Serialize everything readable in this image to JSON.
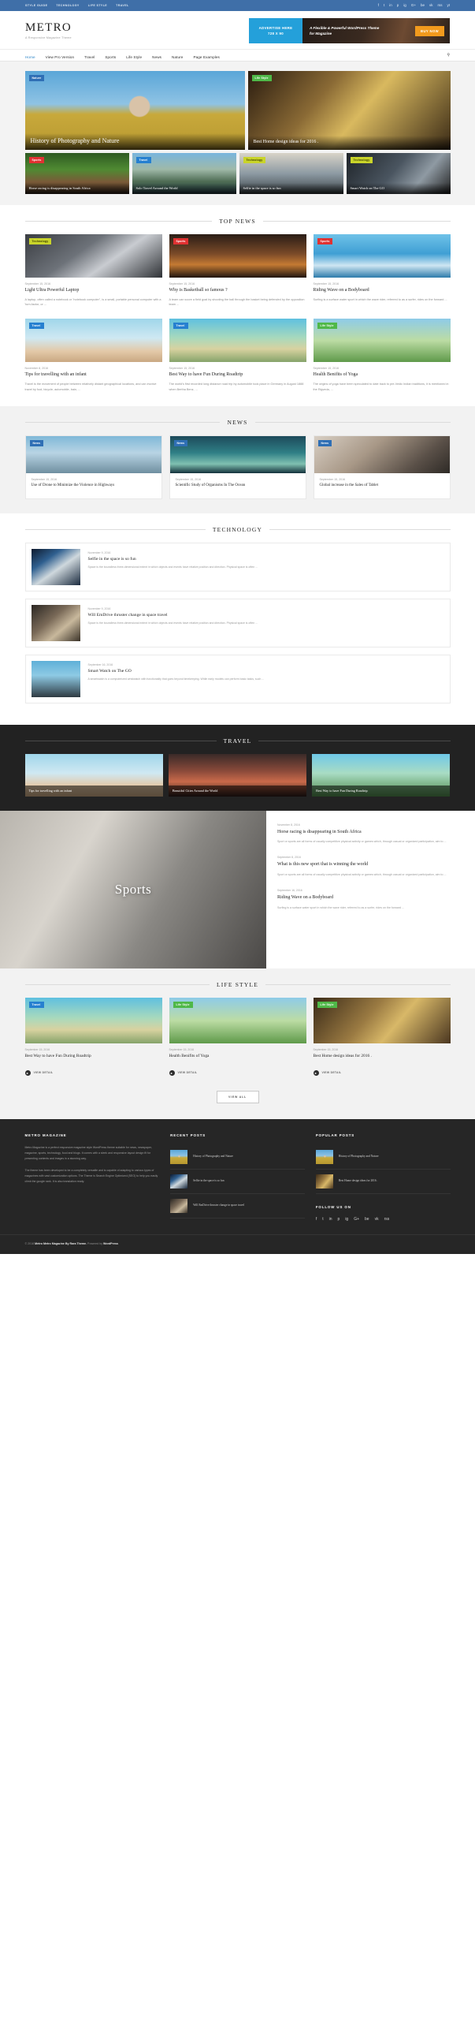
{
  "topbar": {
    "links": [
      "STYLE GUIDE",
      "TECHNOLOGY",
      "LIFE STYLE",
      "TRAVEL"
    ],
    "social": [
      "f",
      "t",
      "in",
      "p",
      "ig",
      "G+",
      "be",
      "vk",
      "rss",
      "yt"
    ],
    "bg": "#3f6fa8"
  },
  "header": {
    "title": "METRO",
    "tagline": "A Responsive Magazine Theme",
    "ad": {
      "left_line1": "ADVERTISE HERE",
      "left_line2": "728 X 90",
      "text": "A Flexible & Powerful WordPress Theme for Magazine",
      "button": "BUY NOW",
      "accent": "#24a0da",
      "button_color": "#f29a1d"
    }
  },
  "nav": {
    "items": [
      "Home",
      "View Pro Version",
      "Travel",
      "Sports",
      "Life Style",
      "News",
      "Nature",
      "Page Examples"
    ],
    "active": "Home",
    "search_icon": "search-icon"
  },
  "hero": {
    "main": {
      "badge": "Nature",
      "badge_class": "b-nature",
      "title": "History of Photography and Nature",
      "img": "i-photographer"
    },
    "side": {
      "badge": "Life Style",
      "badge_class": "b-life",
      "title": "Best Home design ideas for 2016 .",
      "img": "i-interior"
    },
    "small": [
      {
        "badge": "Sports",
        "badge_class": "b-sports",
        "title": "Horse racing is disappearing in South Africa",
        "img": "i-horse"
      },
      {
        "badge": "Travel",
        "badge_class": "b-travel",
        "title": "Solo Travel Around the World",
        "img": "i-mountain"
      },
      {
        "badge": "Technology",
        "badge_class": "b-tech",
        "title": "Selfie in the space is so fun",
        "img": "i-selfie"
      },
      {
        "badge": "Technology",
        "badge_class": "b-tech",
        "title": "Smart Watch on The GO",
        "img": "i-watch"
      }
    ]
  },
  "top_news": {
    "heading": "TOP NEWS",
    "row1": [
      {
        "badge": "Technology",
        "badge_class": "b-tech",
        "img": "i-laptop",
        "date": "September 15, 2016",
        "title": "Light Ultra Powerful Laptop",
        "excerpt": "A laptop, often called a notebook or \"notebook computer\", is a small, portable personal computer with a 'turn-factor, or ..."
      },
      {
        "badge": "Sports",
        "badge_class": "b-sports",
        "img": "i-basket",
        "date": "September 15, 2016",
        "title": "Why is Basketball so famous ?",
        "excerpt": "A team can score a field goal by shooting the ball through the basket being defended by the opposition team ..."
      },
      {
        "badge": "Sports",
        "badge_class": "b-sports",
        "img": "i-surf",
        "date": "September 15, 2016",
        "title": "Riding Wave on a Bodyboard",
        "excerpt": "Surfing is a surface water sport in which the wave rider, referred to as a surfer, rides on the forward ..."
      }
    ],
    "row2": [
      {
        "badge": "Travel",
        "badge_class": "b-travel",
        "img": "i-infant",
        "date": "November 8, 2016",
        "title": "Tips for travelling with an infant",
        "excerpt": "Travel is the movement of people between relatively distant geographical locations, and can involve travel by foot, bicycle, automobile, train, ..."
      },
      {
        "badge": "Travel",
        "badge_class": "b-travel",
        "img": "i-van",
        "date": "September 15, 2016",
        "title": "Best Way to have Fun During Roadtrip",
        "excerpt": "The world's first recorded long distance road trip by automobile took place in Germany in August 1888 when Bertha Benz, ..."
      },
      {
        "badge": "Life Style",
        "badge_class": "b-life",
        "img": "i-yoga2",
        "date": "September 15, 2016",
        "title": "Health Benifits of Yoga",
        "excerpt": "The origins of yoga have been speculated to date back to pre-Vedic Indian traditions, it is mentioned in the Rigveda, ..."
      }
    ]
  },
  "news": {
    "heading": "NEWS",
    "items": [
      {
        "badge": "News",
        "badge_class": "b-news",
        "img": "i-drone",
        "date": "September 15, 2016",
        "title": "Use of Drone to Minimize the Violence in Highways"
      },
      {
        "badge": "News",
        "badge_class": "b-news",
        "img": "i-ocean",
        "date": "September 15, 2016",
        "title": "Scientific Study of Organisms In The Ocean"
      },
      {
        "badge": "News",
        "badge_class": "b-news",
        "img": "i-tablet",
        "date": "September 15, 2016",
        "title": "Global increase in the Sales of Tablet"
      }
    ]
  },
  "technology": {
    "heading": "TECHNOLOGY",
    "items": [
      {
        "img": "i-space",
        "date": "November 9, 2016",
        "title": "Selfie in the space is so fun",
        "excerpt": "Space is the boundless three-dimensional extent in which objects and events have relative position and direction. Physical space is often ..."
      },
      {
        "img": "i-thruster",
        "date": "November 9, 2016",
        "title": "Will EmDrive thruster change in space travel",
        "excerpt": "Space is the boundless three-dimensional extent in which objects and events have relative position and direction. Physical space is often ..."
      },
      {
        "img": "i-smartwatch",
        "date": "September 16, 2016",
        "title": "Smart Watch on The GO",
        "excerpt": "A smartwatch is a computerized wristwatch with functionality that goes beyond timekeeping. While early models can perform basic tasks, such ..."
      }
    ]
  },
  "travel": {
    "heading": "TRAVEL",
    "items": [
      {
        "img": "i-infant",
        "title": "Tips for travelling with an infant"
      },
      {
        "img": "i-cities",
        "title": "Beautiful Cities Around the World"
      },
      {
        "img": "i-palms",
        "title": "Best Way to have Fun During Roadtrip"
      }
    ]
  },
  "sports": {
    "title": "Sports",
    "bg": "i-sports-bg",
    "items": [
      {
        "date": "November 8, 2016",
        "title": "Horse racing is disappearing in South Africa",
        "excerpt": "Sport or sports are all forms of usually competitive physical activity or games which, through casual or organized participation, aim to ..."
      },
      {
        "date": "September 8, 2016",
        "title": "What is this new sport that is winning the world",
        "excerpt": "Sport or sports are all forms of usually competitive physical activity or games which, through casual or organized participation, aim to ..."
      },
      {
        "date": "September 16, 2016",
        "title": "Riding Wave on a Bodyboard",
        "excerpt": "Surfing is a surface water sport in which the wave rider, referred to as a surfer, rides on the forward ..."
      }
    ]
  },
  "life_style": {
    "heading": "LIFE STYLE",
    "detail_label": "VIEW DETAIL",
    "view_all": "VIEW ALL",
    "items": [
      {
        "badge": "Travel",
        "badge_class": "b-travel",
        "img": "i-van",
        "date": "September 15, 2016",
        "title": "Best Way to have Fun During Roadtrip"
      },
      {
        "badge": "Life Style",
        "badge_class": "b-life",
        "img": "i-yoga2",
        "date": "September 15, 2016",
        "title": "Health Benifits of Yoga"
      },
      {
        "badge": "Life Style",
        "badge_class": "b-life",
        "img": "i-house",
        "date": "September 15, 2016",
        "title": "Best Home design ideas for 2016 ."
      }
    ]
  },
  "footer": {
    "about": {
      "heading": "METRO MAGAZINE",
      "p1": "Metro Magazine is a perfect responsive magazine style WordPress theme suitable for news, newspaper, magazine, sports, technology, food and blogs. It comes with a sleek and responsive layout design fit for presenting contents and images in a stunning way.",
      "p2": "The theme has been developed to be a completely versatile and is capable of adapting to various types of magazines with vast customization options. The Theme is Search Engine Optimized (SEO) to help you easily climb the google rank. It is also translation ready."
    },
    "recent": {
      "heading": "RECENT POSTS",
      "items": [
        {
          "img": "i-photographer",
          "title": "History of Photography and Nature"
        },
        {
          "img": "i-space",
          "title": "Selfie in the space is so fun"
        },
        {
          "img": "i-thruster",
          "title": "Will EmDrive thruster change in space travel"
        }
      ]
    },
    "popular": {
      "heading": "POPULAR POSTS",
      "items": [
        {
          "img": "i-photographer",
          "title": "History of Photography and Nature"
        },
        {
          "img": "i-house",
          "title": "Best Home design ideas for 2016 ."
        }
      ]
    },
    "follow": {
      "heading": "FOLLOW US ON",
      "icons": [
        "f",
        "t",
        "in",
        "p",
        "ig",
        "G+",
        "be",
        "vk",
        "rss"
      ]
    },
    "copyright_year": "© 2018",
    "copyright_bold": "Metro Metro Magazine By Rara Theme.",
    "copyright_rest": " Powered by ",
    "copyright_wp": "WordPress"
  }
}
